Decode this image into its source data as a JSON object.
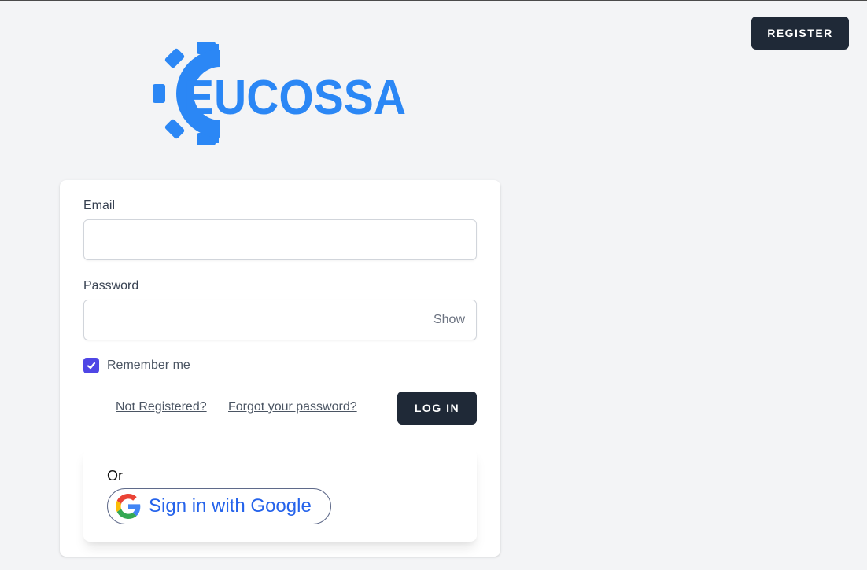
{
  "header": {
    "register_label": "REGISTER"
  },
  "logo": {
    "text": "EUCOSSA",
    "color": "#2b87f5"
  },
  "form": {
    "email_label": "Email",
    "email_value": "",
    "password_label": "Password",
    "password_value": "",
    "show_label": "Show",
    "remember_label": "Remember me",
    "remember_checked": true,
    "not_registered_link": "Not Registered?",
    "forgot_link": "Forgot your password?",
    "login_label": "LOG IN"
  },
  "alt_login": {
    "or_text": "Or",
    "google_label": "Sign in with Google"
  },
  "colors": {
    "background": "#f3f4f6",
    "dark_button": "#1f2937",
    "checkbox": "#4f46e5",
    "google_text": "#2563eb"
  },
  "icons": {
    "logo": "gear-icon",
    "checkbox": "checkmark-icon",
    "google": "google-g-icon"
  }
}
